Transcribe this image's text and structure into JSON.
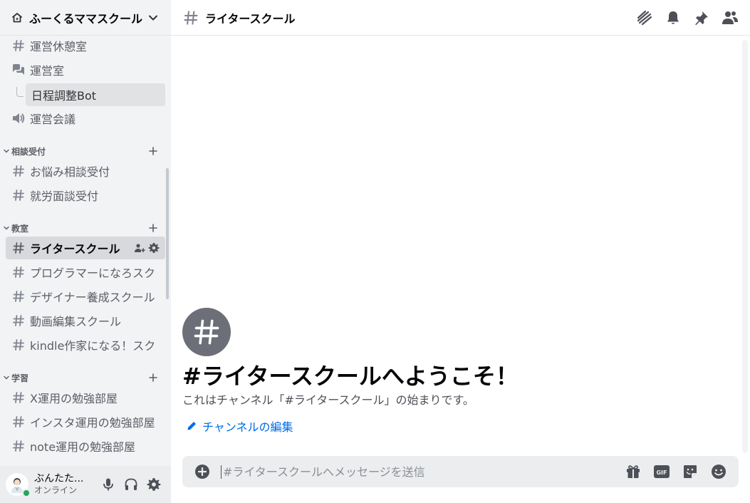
{
  "server": {
    "name": "ふーくるママスクール",
    "icon": "home-icon"
  },
  "sidebar": {
    "top_channels": [
      {
        "label": "運営休憩室",
        "icon": "hash-icon"
      },
      {
        "label": "運営室",
        "icon": "forum-icon"
      },
      {
        "label": "運営会議",
        "icon": "voice-icon"
      }
    ],
    "thread": {
      "label": "日程調整Bot"
    },
    "categories": [
      {
        "name": "相談受付",
        "channels": [
          "お悩み相談受付",
          "就労面談受付"
        ]
      },
      {
        "name": "教室",
        "channels": [
          "ライタースクール",
          "プログラマーになろスク",
          "デザイナー養成スクール",
          "動画編集スクール",
          "kindle作家になる！スク"
        ]
      },
      {
        "name": "学習",
        "channels": [
          "X運用の勉強部屋",
          "インスタ運用の勉強部屋",
          "note運用の勉強部屋"
        ]
      }
    ],
    "active_channel": "ライタースクール"
  },
  "user": {
    "name": "ぶんたた...",
    "status": "オンライン",
    "status_color": "#23a55a"
  },
  "header": {
    "channel_name": "ライタースクール"
  },
  "welcome": {
    "title": "#ライタースクールへようこそ！",
    "description": "これはチャンネル「#ライタースクール」の始まりです。",
    "edit_label": "チャンネルの編集"
  },
  "composer": {
    "placeholder": "#ライタースクールへメッセージを送信",
    "value": ""
  },
  "colors": {
    "accent_link": "#006ce7",
    "sidebar_bg": "#f2f3f5",
    "active_bg": "#d7d9dc",
    "online": "#23a55a"
  }
}
